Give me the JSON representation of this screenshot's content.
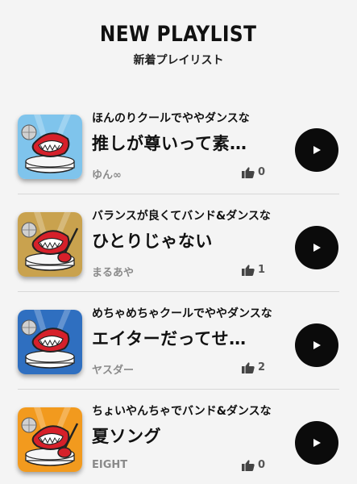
{
  "header": {
    "title": "NEW PLAYLIST",
    "subtitle": "新着プレイリスト"
  },
  "playlists": [
    {
      "description": "ほんのりクールでややダンスな",
      "name": "推しが尊いって素…",
      "author": "ゆん∞",
      "likes": "0",
      "thumb_bg": "#7fc4ec",
      "thumb_icon": "mouth-stage-icon"
    },
    {
      "description": "バランスが良くてバンド&ダンスな",
      "name": "ひとりじゃない",
      "author": "まるあや",
      "likes": "1",
      "thumb_bg": "#c9a24e",
      "thumb_icon": "mouth-guitar-icon"
    },
    {
      "description": "めちゃめちゃクールでややダンスな",
      "name": "エイターだってせ…",
      "author": "ヤスダー",
      "likes": "2",
      "thumb_bg": "#2f6fc0",
      "thumb_icon": "mouth-stage-icon"
    },
    {
      "description": "ちょいやんちゃでバンド&ダンスな",
      "name": "夏ソング",
      "author": "EIGHT",
      "likes": "0",
      "thumb_bg": "#f29a1e",
      "thumb_icon": "mouth-guitar-icon"
    }
  ],
  "icons": {
    "like": "thumbs-up-icon",
    "play": "play-icon"
  },
  "colors": {
    "background": "#f4f4f4",
    "play_button": "#0b0b0b",
    "mouth_red": "#d6202a",
    "muted_text": "#8a8a8a"
  }
}
